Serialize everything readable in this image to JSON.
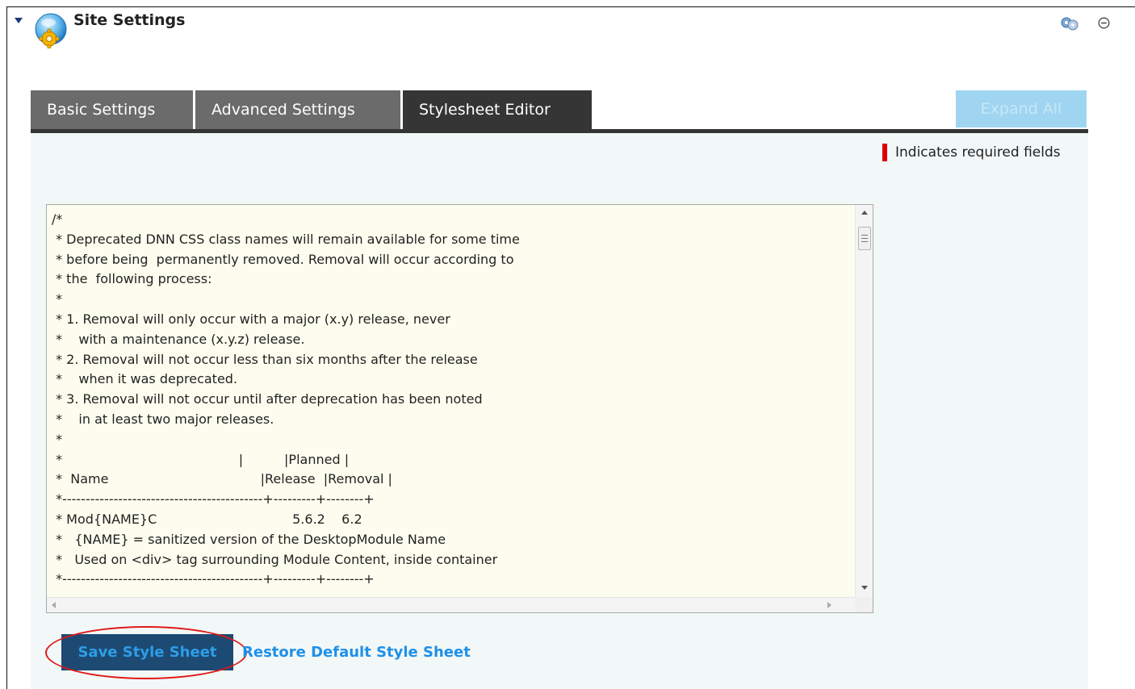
{
  "module": {
    "title": "Site Settings",
    "icon": "gear-globe-icon",
    "tools_icon": "module-actions-icon",
    "minimize_icon": "minimize-icon"
  },
  "tabs": [
    {
      "label": "Basic Settings",
      "active": false
    },
    {
      "label": "Advanced Settings",
      "active": false
    },
    {
      "label": "Stylesheet Editor",
      "active": true
    }
  ],
  "expand_all_label": "Expand All",
  "required_note": "Indicates required fields",
  "editor": {
    "content": "/*\n * Deprecated DNN CSS class names will remain available for some time\n * before being  permanently removed. Removal will occur according to\n * the  following process:\n *\n * 1. Removal will only occur with a major (x.y) release, never\n *    with a maintenance (x.y.z) release.\n * 2. Removal will not occur less than six months after the release\n *    when it was deprecated.\n * 3. Removal will not occur until after deprecation has been noted\n *    in at least two major releases.\n *\n *                                           |          |Planned |\n *  Name                                     |Release  |Removal |\n *-------------------------------------------+---------+--------+\n * Mod{NAME}C                                 5.6.2    6.2\n *   {NAME} = sanitized version of the DesktopModule Name\n *   Used on <div> tag surrounding Module Content, inside container\n *-------------------------------------------+---------+--------+"
  },
  "buttons": {
    "save": "Save Style Sheet",
    "restore": "Restore Default Style Sheet"
  },
  "colors": {
    "tab_inactive": "#6b6b6b",
    "tab_active": "#353535",
    "panel_bg": "#f2f8f8",
    "editor_bg": "#fdfdef",
    "save_button_bg": "#1c4a73",
    "link_color": "#1e90e8",
    "required_marker": "#e10000",
    "highlight_ellipse": "#e01919"
  }
}
